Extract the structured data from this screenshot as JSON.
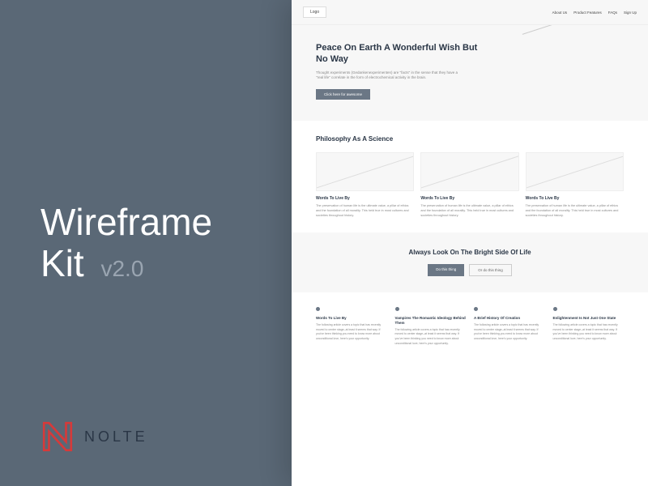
{
  "left": {
    "title_line1": "Wireframe",
    "title_line2": "Kit",
    "version": "v2.0",
    "brand": "NOLTE"
  },
  "mockup": {
    "logo": "Logo",
    "nav": [
      "About Us",
      "Product Features",
      "FAQs",
      "Sign Up"
    ],
    "hero": {
      "title": "Peace On Earth A Wonderful Wish But No Way",
      "subtitle": "Thought experiments (Gedankenexperimenten) are \"facts\" in the sense that they have a \"real life\" correlate in the form of electrochemical activity in the brain.",
      "button": "Click here for awesome"
    },
    "section1": {
      "title": "Philosophy As A Science",
      "cards": [
        {
          "title": "Words To Live By",
          "text": "The preservation of human life is the ultimate value, a pillar of ethics and the foundation of all morality. This held true in most cultures and societies throughout history."
        },
        {
          "title": "Words To Live By",
          "text": "The preservation of human life is the ultimate value, a pillar of ethics and the foundation of all morality. This held true in most cultures and societies throughout history."
        },
        {
          "title": "Words To Live By",
          "text": "The preservation of human life is the ultimate value, a pillar of ethics and the foundation of all morality. This held true in most cultures and societies throughout history."
        }
      ]
    },
    "cta": {
      "title": "Always Look On The Bright Side Of Life",
      "primary": "Do this thing",
      "secondary": "Or do this thing"
    },
    "features": [
      {
        "title": "Words To Live By",
        "text": "The following article covers a topic that has recently moved to center stage–at least it seems that way. If you've been thinking you need to know more about unconditional love, here's your opportunity."
      },
      {
        "title": "Vampires The Romantic Ideology Behind Them",
        "text": "The following article covers a topic that has recently moved to center stage–at least it seems that way. If you've been thinking you need to know more about unconditional love, here's your opportunity."
      },
      {
        "title": "A Brief History Of Creation",
        "text": "The following article covers a topic that has recently moved to center stage–at least it seems that way. If you've been thinking you need to know more about unconditional love, here's your opportunity."
      },
      {
        "title": "Enlightenment Is Not Just One State",
        "text": "The following article covers a topic that has recently moved to center stage–at least it seems that way. If you've been thinking you need to know more about unconditional love, here's your opportunity."
      }
    ]
  }
}
